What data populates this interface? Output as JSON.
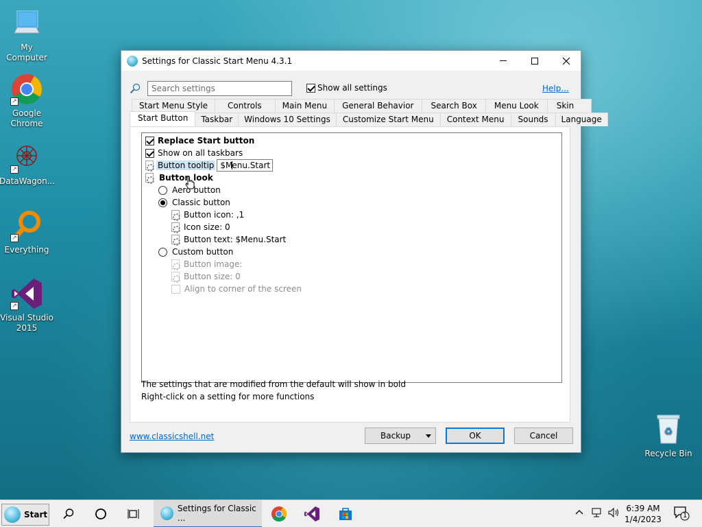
{
  "desktop": {
    "icons": [
      {
        "label": "My Computer",
        "icon": "monitor-icon"
      },
      {
        "label": "Google Chrome",
        "icon": "chrome-icon"
      },
      {
        "label": "DataWagon...",
        "icon": "datawagon-icon"
      },
      {
        "label": "Everything",
        "icon": "everything-search-icon"
      },
      {
        "label": "Visual Studio 2015",
        "icon": "visual-studio-icon"
      },
      {
        "label": "Recycle Bin",
        "icon": "recycle-bin-icon"
      }
    ]
  },
  "window": {
    "title": "Settings for Classic Start Menu 4.3.1",
    "search_placeholder": "Search settings",
    "show_all_label": "Show all settings",
    "show_all_checked": true,
    "help_label": "Help...",
    "tabs_row1": [
      "Start Menu Style",
      "Controls",
      "Main Menu",
      "General Behavior",
      "Search Box",
      "Menu Look",
      "Skin"
    ],
    "tabs_row2": [
      "Start Button",
      "Taskbar",
      "Windows 10 Settings",
      "Customize Start Menu",
      "Context Menu",
      "Sounds",
      "Language"
    ],
    "active_tab": "Start Button",
    "settings": {
      "replace_start": "Replace Start button",
      "show_all_taskbars": "Show on all taskbars",
      "button_tooltip": "Button tooltip",
      "tooltip_value_before_caret": "$M",
      "tooltip_value_after_caret": "enu.Start",
      "button_look": "Button look",
      "aero_button": "Aero button",
      "classic_button": "Classic button",
      "button_icon": "Button icon: ,1",
      "icon_size": "Icon size: 0",
      "button_text": "Button text: $Menu.Start",
      "custom_button": "Custom button",
      "button_image": "Button image:",
      "button_size": "Button size: 0",
      "align_corner": "Align to corner of the screen"
    },
    "note1": "The settings that are modified from the default will show in bold",
    "note2": "Right-click on a setting for more functions",
    "website": "www.classicshell.net",
    "backup_label": "Backup",
    "ok_label": "OK",
    "cancel_label": "Cancel"
  },
  "taskbar": {
    "start_label": "Start",
    "active_task": "Settings for Classic ...",
    "time": "6:39 AM",
    "date": "1/4/2023",
    "notification_count": "1"
  }
}
